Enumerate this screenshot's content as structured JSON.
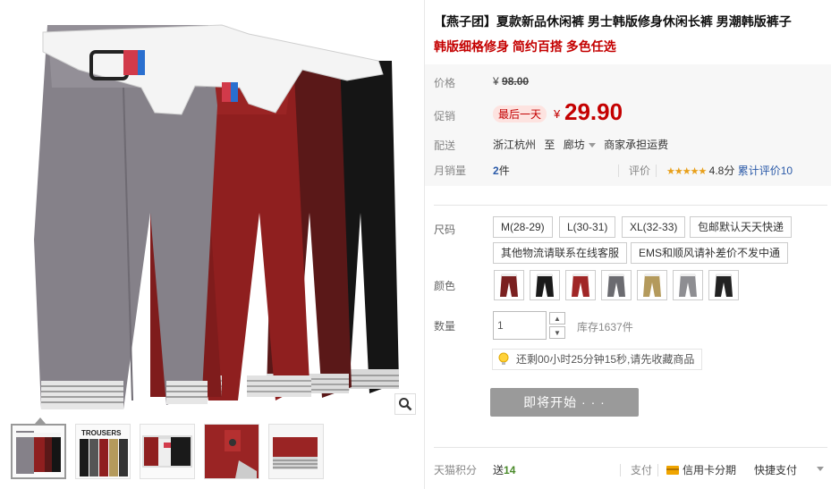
{
  "product": {
    "title": "【燕子团】夏款新品休闲裤 男士韩版修身休闲长裤 男潮韩版裤子",
    "subtitle": "韩版细格修身 简约百搭 多色任选"
  },
  "pricing": {
    "price_label": "价格",
    "original_currency": "¥",
    "original_price": "98.00",
    "promo_label": "促销",
    "promo_tag": "最后一天",
    "currency": "¥",
    "promo_price": "29.90"
  },
  "shipping": {
    "label": "配送",
    "from": "浙江杭州",
    "to_word": "至",
    "destination": "廊坊",
    "fee": "商家承担运费"
  },
  "sales": {
    "label": "月销量",
    "count": "2",
    "unit": "件",
    "rating_label": "评价",
    "stars": "★★★★★",
    "score": "4.8分",
    "reviews": "累计评价10",
    "rating": 4.8
  },
  "size": {
    "label": "尺码",
    "options": [
      "M(28-29)",
      "L(30-31)",
      "XL(32-33)",
      "包邮默认天天快递",
      "其他物流请联系在线客服",
      "EMS和顺风请补差价不发中通"
    ]
  },
  "color": {
    "label": "颜色",
    "swatches": [
      {
        "name": "wine",
        "color": "#7a2020"
      },
      {
        "name": "black",
        "color": "#1a1a1a"
      },
      {
        "name": "red",
        "color": "#a02626"
      },
      {
        "name": "gray-dark",
        "color": "#6b6b70"
      },
      {
        "name": "khaki",
        "color": "#b49a5c"
      },
      {
        "name": "gray",
        "color": "#8e8e92"
      },
      {
        "name": "black2",
        "color": "#222"
      }
    ]
  },
  "quantity": {
    "label": "数量",
    "value": "1",
    "stock": "库存1637件"
  },
  "tip": {
    "text": "还剩00小时25分钟15秒,请先收藏商品"
  },
  "buy": {
    "label": "即将开始 · · ·"
  },
  "footer": {
    "points_label": "天猫积分",
    "points_prefix": "送",
    "points_value": "14",
    "pay_label": "支付",
    "credit": "信用卡分期",
    "quick": "快捷支付"
  },
  "colors": {
    "accent_red": "#c40000",
    "price_bg": "#f7f7f7",
    "button_gray": "#9a9a9a",
    "link_blue": "#2b5aa8"
  }
}
